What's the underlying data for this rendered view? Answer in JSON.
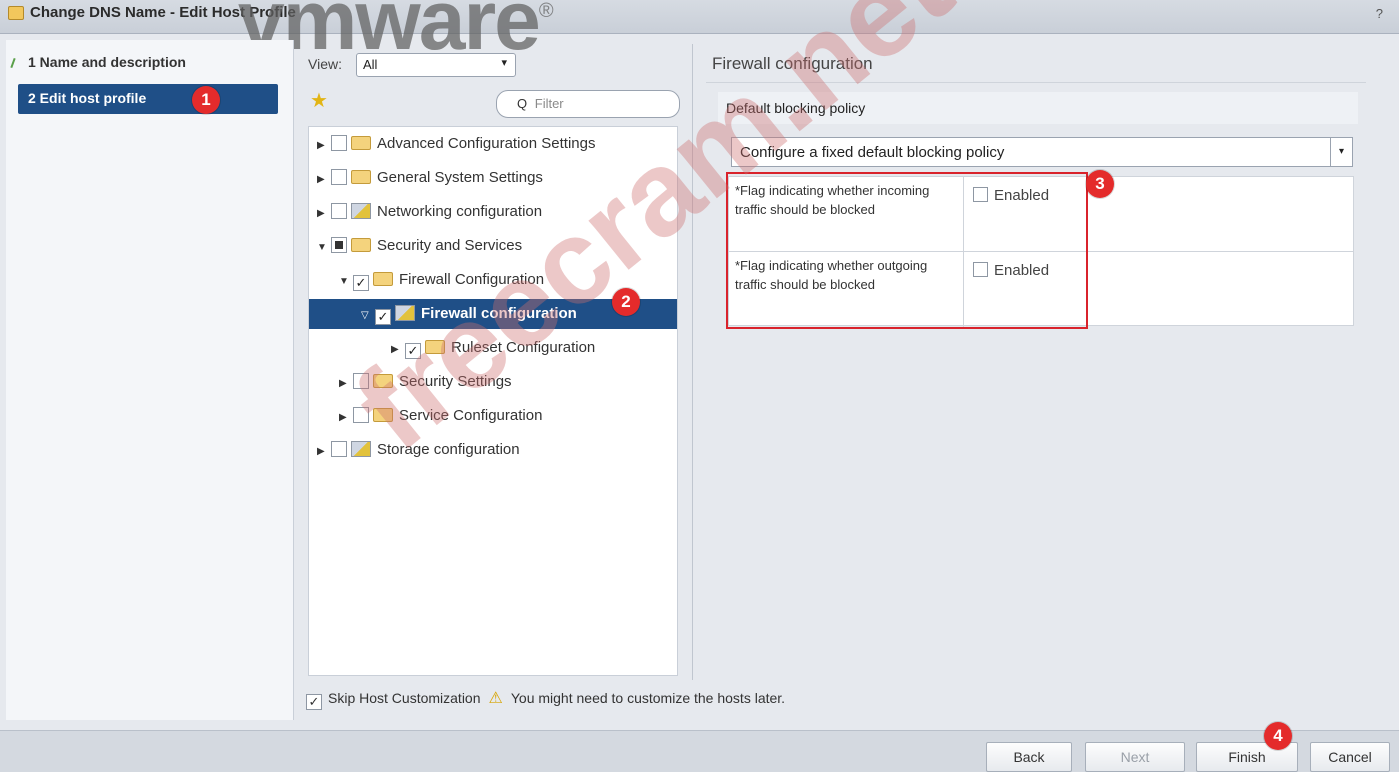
{
  "window": {
    "title": "Change DNS Name - Edit Host Profile",
    "help_icon": "?"
  },
  "watermarks": {
    "logo": "vmware",
    "logo_mark": "®",
    "site": "freecram.net"
  },
  "steps": [
    {
      "label": "1  Name and description"
    },
    {
      "label": "2  Edit host profile"
    }
  ],
  "tree_toolbar": {
    "view_label": "View:",
    "view_value": "All",
    "filter_placeholder": "Filter"
  },
  "tree": [
    {
      "label": "Advanced Configuration Settings",
      "expanded": false,
      "checked": false,
      "icon": "folder-icon"
    },
    {
      "label": "General System Settings",
      "expanded": false,
      "checked": false,
      "icon": "folder-icon"
    },
    {
      "label": "Networking configuration",
      "expanded": false,
      "checked": false,
      "icon": "network-icon"
    },
    {
      "label": "Security and Services",
      "expanded": true,
      "checked": "partial",
      "icon": "folder-icon"
    },
    {
      "label": "Firewall Configuration",
      "expanded": true,
      "checked": true,
      "icon": "folder-icon"
    },
    {
      "label": "Firewall configuration",
      "expanded": true,
      "checked": true,
      "icon": "network-icon",
      "selected": true
    },
    {
      "label": "Ruleset Configuration",
      "expanded": false,
      "checked": true,
      "icon": "folder-icon"
    },
    {
      "label": "Security Settings",
      "expanded": false,
      "checked": false,
      "icon": "folder-icon"
    },
    {
      "label": "Service Configuration",
      "expanded": false,
      "checked": false,
      "icon": "folder-icon"
    },
    {
      "label": "Storage configuration",
      "expanded": false,
      "checked": false,
      "icon": "network-icon"
    }
  ],
  "right_panel": {
    "title": "Firewall configuration",
    "section_label": "Default blocking policy",
    "policy_value": "Configure a fixed default blocking policy",
    "flags": [
      {
        "text": "*Flag indicating whether incoming traffic should be blocked",
        "check_label": "Enabled",
        "checked": false
      },
      {
        "text": "*Flag indicating whether outgoing traffic should be blocked",
        "check_label": "Enabled",
        "checked": false
      }
    ]
  },
  "skip": {
    "label": "Skip Host Customization",
    "checked": true,
    "warning": "You might need to customize the hosts later."
  },
  "badges": [
    "1",
    "2",
    "3",
    "4"
  ],
  "buttons": {
    "back": "Back",
    "next": "Next",
    "finish": "Finish",
    "cancel": "Cancel"
  },
  "colors": {
    "selection": "#1f4f87",
    "annotation_red": "#e42b2b"
  }
}
